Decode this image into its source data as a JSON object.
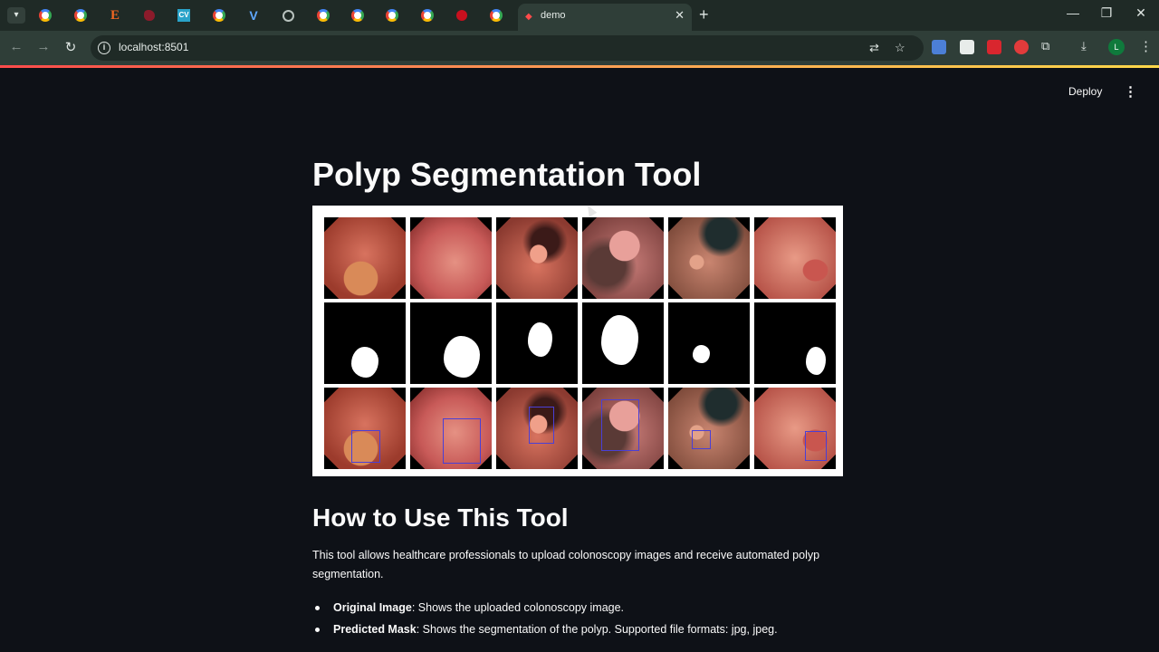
{
  "browser": {
    "active_tab_title": "demo",
    "url": "localhost:8501",
    "profile_initial": "L",
    "pinned_tab_icons": [
      "google-icon",
      "google-icon",
      "e-icon",
      "red-bird-icon",
      "cv-icon",
      "google-icon",
      "v-icon",
      "globe-icon",
      "google-icon",
      "google-icon",
      "google-icon",
      "red-circle-icon",
      "google-icon"
    ]
  },
  "app": {
    "deploy_label": "Deploy",
    "title": "Polyp Segmentation Tool",
    "howto_heading": "How to Use This Tool",
    "intro": "This tool allows healthcare professionals to upload colonoscopy images and receive automated polyp segmentation.",
    "bullets": [
      {
        "term": "Original Image",
        "text": ": Shows the uploaded colonoscopy image."
      },
      {
        "term": "Predicted Mask",
        "text": ": Shows the segmentation of the polyp. Supported file formats: jpg, jpeg."
      }
    ]
  },
  "colors": {
    "background": "#0e1117",
    "text": "#fafafa",
    "accent": "#ff4b4b",
    "bbox": "#4a3fd6"
  }
}
